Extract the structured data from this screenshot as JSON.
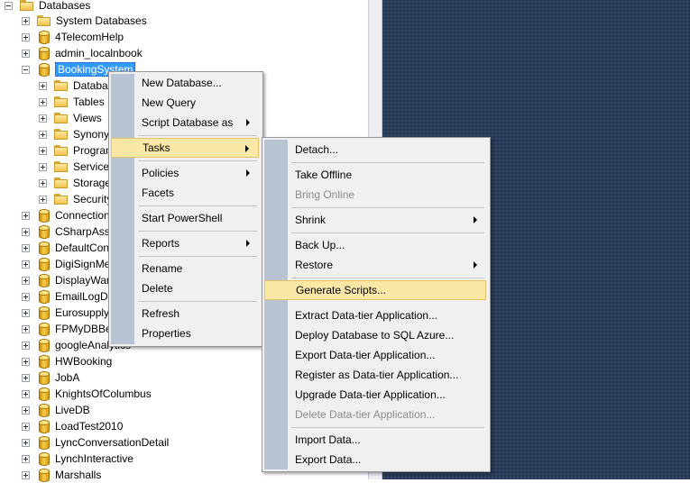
{
  "tree": {
    "root": "Databases",
    "nodes": [
      {
        "label": "System Databases",
        "icon": "folder",
        "level": 1
      },
      {
        "label": "4TelecomHelp",
        "icon": "database",
        "level": 1
      },
      {
        "label": "admin_localnbook",
        "icon": "database",
        "level": 1
      },
      {
        "label": "BookingSystem",
        "icon": "database",
        "level": 1,
        "selected": true,
        "expanded": true
      },
      {
        "label": "Databas",
        "icon": "folder",
        "level": 2
      },
      {
        "label": "Tables",
        "icon": "folder",
        "level": 2
      },
      {
        "label": "Views",
        "icon": "folder",
        "level": 2
      },
      {
        "label": "Synonyi",
        "icon": "folder",
        "level": 2
      },
      {
        "label": "Progran",
        "icon": "folder",
        "level": 2
      },
      {
        "label": "Service",
        "icon": "folder",
        "level": 2
      },
      {
        "label": "Storage",
        "icon": "folder",
        "level": 2
      },
      {
        "label": "Security",
        "icon": "folder",
        "level": 2
      },
      {
        "label": "Connection",
        "icon": "database",
        "level": 1
      },
      {
        "label": "CSharpAssi",
        "icon": "database",
        "level": 1
      },
      {
        "label": "DefaultCon",
        "icon": "database",
        "level": 1
      },
      {
        "label": "DigiSignMe",
        "icon": "database",
        "level": 1
      },
      {
        "label": "DisplayWar",
        "icon": "database",
        "level": 1
      },
      {
        "label": "EmailLogDe",
        "icon": "database",
        "level": 1
      },
      {
        "label": "Eurosupply",
        "icon": "database",
        "level": 1
      },
      {
        "label": "FPMyDBBet",
        "icon": "database",
        "level": 1
      },
      {
        "label": "googleAnalytics",
        "icon": "database",
        "level": 1
      },
      {
        "label": "HWBooking",
        "icon": "database",
        "level": 1
      },
      {
        "label": "JobA",
        "icon": "database",
        "level": 1
      },
      {
        "label": "KnightsOfColumbus",
        "icon": "database",
        "level": 1
      },
      {
        "label": "LiveDB",
        "icon": "database",
        "level": 1
      },
      {
        "label": "LoadTest2010",
        "icon": "database",
        "level": 1
      },
      {
        "label": "LyncConversationDetail",
        "icon": "database",
        "level": 1
      },
      {
        "label": "LynchInteractive",
        "icon": "database",
        "level": 1
      },
      {
        "label": "Marshalls",
        "icon": "database",
        "level": 1
      }
    ]
  },
  "context_menu": {
    "items": [
      {
        "label": "New Database...",
        "submenu": false
      },
      {
        "label": "New Query",
        "submenu": false
      },
      {
        "label": "Script Database as",
        "submenu": true
      },
      {
        "label": "Tasks",
        "submenu": true,
        "highlighted": true
      },
      {
        "label": "Policies",
        "submenu": true
      },
      {
        "label": "Facets",
        "submenu": false
      },
      {
        "label": "Start PowerShell",
        "submenu": false
      },
      {
        "label": "Reports",
        "submenu": true
      },
      {
        "label": "Rename",
        "submenu": false
      },
      {
        "label": "Delete",
        "submenu": false
      },
      {
        "label": "Refresh",
        "submenu": false
      },
      {
        "label": "Properties",
        "submenu": false
      }
    ]
  },
  "tasks_menu": {
    "items": [
      {
        "label": "Detach...",
        "submenu": false
      },
      {
        "label": "Take Offline",
        "submenu": false
      },
      {
        "label": "Bring Online",
        "submenu": false,
        "disabled": true
      },
      {
        "label": "Shrink",
        "submenu": true
      },
      {
        "label": "Back Up...",
        "submenu": false
      },
      {
        "label": "Restore",
        "submenu": true
      },
      {
        "label": "Generate Scripts...",
        "submenu": false,
        "highlighted": true
      },
      {
        "label": "Extract Data-tier Application...",
        "submenu": false
      },
      {
        "label": "Deploy Database to SQL Azure...",
        "submenu": false
      },
      {
        "label": "Export Data-tier Application...",
        "submenu": false
      },
      {
        "label": "Register as Data-tier Application...",
        "submenu": false
      },
      {
        "label": "Upgrade Data-tier Application...",
        "submenu": false
      },
      {
        "label": "Delete Data-tier Application...",
        "submenu": false,
        "disabled": true
      },
      {
        "label": "Import Data...",
        "submenu": false
      },
      {
        "label": "Export Data...",
        "submenu": false
      }
    ]
  },
  "colors": {
    "menu_background": "#f0f0f0",
    "menu_gutter": "#b9c4d3",
    "highlight": "#fbe8a6",
    "selection": "#3399ff",
    "right_pane": "#2b3c59"
  }
}
